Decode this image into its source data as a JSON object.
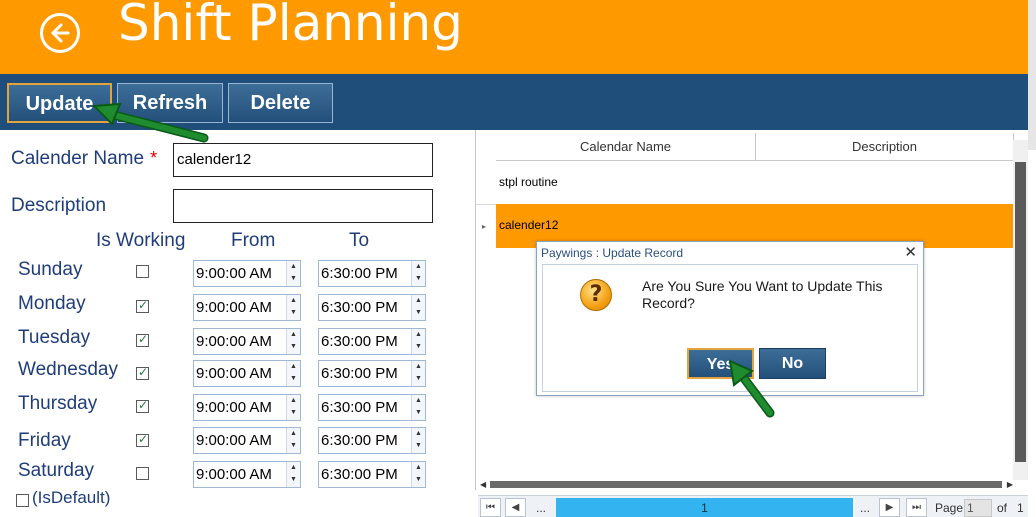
{
  "header": {
    "title": "Shift Planning",
    "back_icon": "back-arrow-icon",
    "bg": "#FF9900"
  },
  "toolbar": {
    "update_label": "Update",
    "refresh_label": "Refresh",
    "delete_label": "Delete"
  },
  "form": {
    "calendar_name_label": "Calender Name",
    "required_mark": "*",
    "calendar_name_value": "calender12",
    "description_label": "Description",
    "description_value": "",
    "col_is_working": "Is Working",
    "col_from": "From",
    "col_to": "To",
    "days": [
      {
        "name": "Sunday",
        "working": false,
        "from": "9:00:00 AM",
        "to": "6:30:00 PM"
      },
      {
        "name": "Monday",
        "working": true,
        "from": "9:00:00 AM",
        "to": "6:30:00 PM"
      },
      {
        "name": "Tuesday",
        "working": true,
        "from": "9:00:00 AM",
        "to": "6:30:00 PM"
      },
      {
        "name": "Wednesday",
        "working": true,
        "from": "9:00:00 AM",
        "to": "6:30:00 PM"
      },
      {
        "name": "Thursday",
        "working": true,
        "from": "9:00:00 AM",
        "to": "6:30:00 PM"
      },
      {
        "name": "Friday",
        "working": true,
        "from": "9:00:00 AM",
        "to": "6:30:00 PM"
      },
      {
        "name": "Saturday",
        "working": false,
        "from": "9:00:00 AM",
        "to": "6:30:00 PM"
      }
    ],
    "is_default_label": "(IsDefault)",
    "is_default_checked": false
  },
  "grid": {
    "columns": [
      "Calendar Name",
      "Description"
    ],
    "rows": [
      {
        "name": "stpl routine",
        "description": ""
      },
      {
        "name": "calender12",
        "description": ""
      }
    ],
    "selected_row_color": "#FF9900"
  },
  "pager": {
    "current": "1",
    "page_label": "Page",
    "page_input": "1",
    "of_label": "of",
    "total": "1",
    "ellipsis": "..."
  },
  "dialog": {
    "title": "Paywings : Update Record",
    "close": "✕",
    "message": "Are You Sure You Want to Update This Record?",
    "icon": "question-icon",
    "yes_label": "Yes",
    "no_label": "No"
  },
  "annotation_color": "#1E8C2E"
}
